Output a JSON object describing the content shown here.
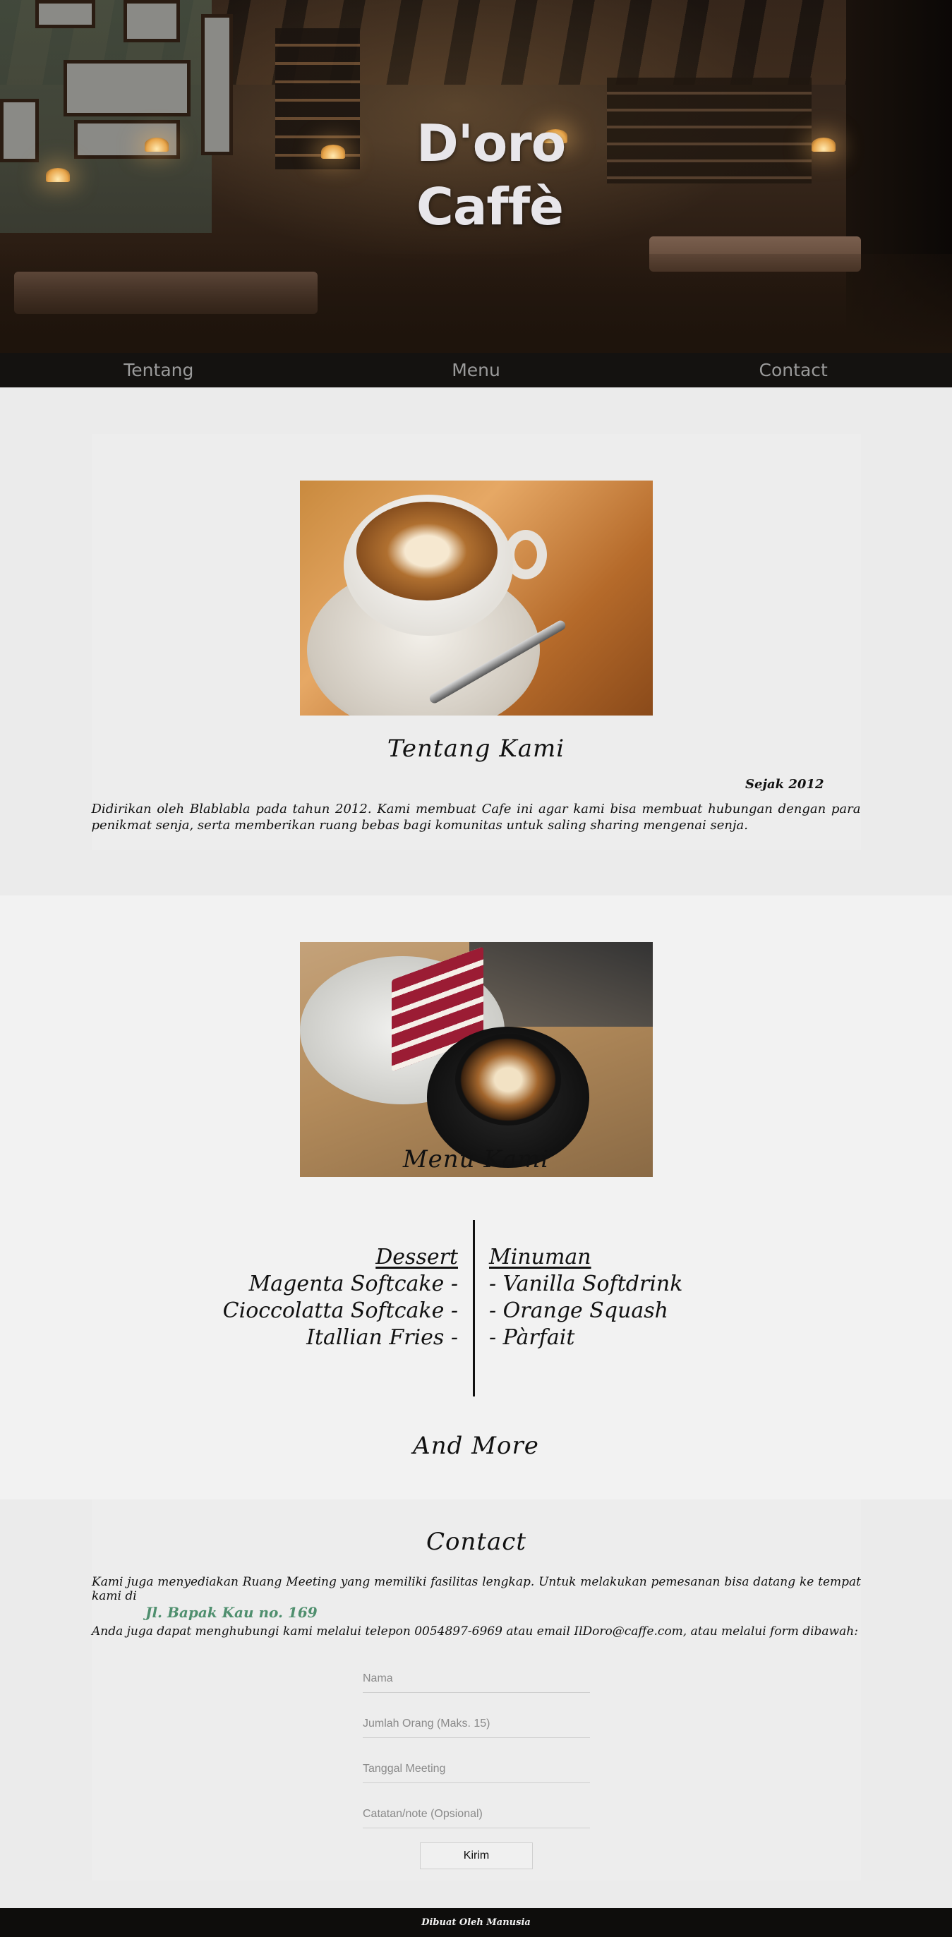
{
  "hero": {
    "title": "D'oro\nCaffè"
  },
  "nav": {
    "items": [
      "Tentang",
      "Menu",
      "Contact"
    ]
  },
  "about": {
    "image_alt": "latte-art-coffee-photo",
    "title": "Tentang Kami",
    "since": "Sejak 2012",
    "text": "Didirikan oleh Blablabla pada tahun 2012. Kami membuat Cafe ini agar kami bisa membuat hubungan dengan para penikmat senja, serta memberikan ruang bebas bagi komunitas untuk saling sharing mengenai senja."
  },
  "menu": {
    "image_alt": "cake-and-coffee-photo",
    "title": "Menu Kami",
    "dessert": {
      "heading": "Dessert",
      "items": [
        "Magenta Softcake -",
        "Cioccolatta Softcake -",
        "Itallian Fries -"
      ]
    },
    "drinks": {
      "heading": "Minuman",
      "items": [
        "- Vanilla Softdrink",
        "- Orange Squash",
        "- Pàrfait"
      ]
    },
    "and_more": "And More"
  },
  "contact": {
    "title": "Contact",
    "text1": "Kami juga menyediakan Ruang Meeting yang memiliki fasilitas lengkap. Untuk melakukan pemesanan bisa datang ke tempat kami di",
    "address": "Jl. Bapak Kau no. 169",
    "text2": "Anda juga dapat menghubungi kami melalui telepon 0054897-6969 atau email IlDoro@caffe.com, atau melalui form dibawah:",
    "form": {
      "name_placeholder": "Nama",
      "people_placeholder": "Jumlah Orang (Maks. 15)",
      "date_placeholder": "Tanggal Meeting",
      "note_placeholder": "Catatan/note (Opsional)",
      "submit_label": "Kirim"
    }
  },
  "footer": {
    "text": "Dibuat Oleh Manusia"
  },
  "colors": {
    "nav_bg": "#141210",
    "footer_bg": "#0e0d0c",
    "address_green": "#4f8f6e",
    "hero_text": "#e8e6ea"
  }
}
